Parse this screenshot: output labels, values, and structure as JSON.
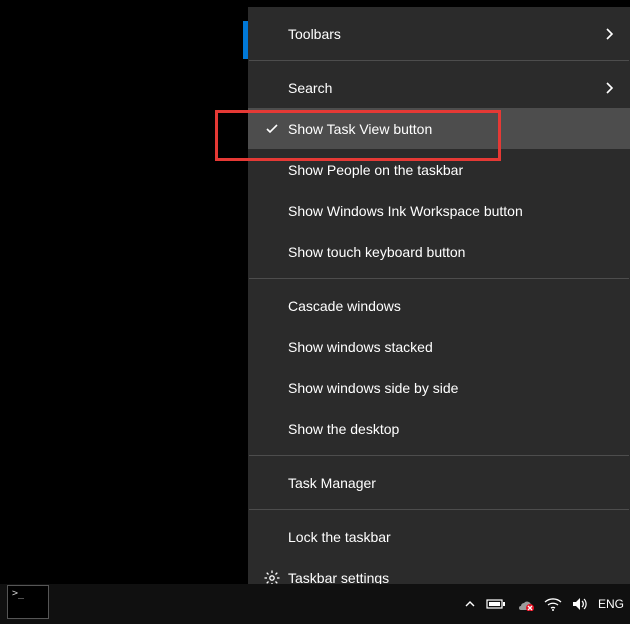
{
  "menu": {
    "groups": [
      {
        "items": [
          {
            "id": "toolbars",
            "label": "Toolbars",
            "submenu": true
          }
        ]
      },
      {
        "items": [
          {
            "id": "search",
            "label": "Search",
            "submenu": true
          },
          {
            "id": "show-task-view",
            "label": "Show Task View button",
            "checked": true,
            "highlighted": true
          },
          {
            "id": "show-people",
            "label": "Show People on the taskbar"
          },
          {
            "id": "show-ink",
            "label": "Show Windows Ink Workspace button"
          },
          {
            "id": "show-touch-kb",
            "label": "Show touch keyboard button"
          }
        ]
      },
      {
        "items": [
          {
            "id": "cascade",
            "label": "Cascade windows"
          },
          {
            "id": "stacked",
            "label": "Show windows stacked"
          },
          {
            "id": "side-by-side",
            "label": "Show windows side by side"
          },
          {
            "id": "show-desktop",
            "label": "Show the desktop"
          }
        ]
      },
      {
        "items": [
          {
            "id": "task-manager",
            "label": "Task Manager"
          }
        ]
      },
      {
        "items": [
          {
            "id": "lock-taskbar",
            "label": "Lock the taskbar"
          },
          {
            "id": "taskbar-settings",
            "label": "Taskbar settings",
            "icon": "gear"
          }
        ]
      }
    ]
  },
  "tray": {
    "language": "ENG"
  }
}
